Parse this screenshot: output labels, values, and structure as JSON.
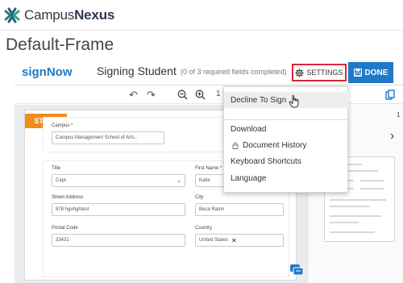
{
  "app": {
    "brand_prefix": "Campus",
    "brand_suffix": "Nexus",
    "frame_title": "Default-Frame"
  },
  "signnow": {
    "logo": "signNow",
    "title": "Signing Student",
    "subtitle": "(0 of 3 required fields completed)",
    "settings_label": "SETTINGS",
    "done_label": "DONE",
    "page_num": "1",
    "thumb_page": "1"
  },
  "document": {
    "start_label": "START",
    "campus_label": "Campus *",
    "campus_value": "Campus Management School of Arts..",
    "title_label": "Title",
    "title_value": "Capt.",
    "first_name_label": "First Name *",
    "first_name_value": "Katie",
    "street_label": "Street Address",
    "street_value": "878 hguhghtest",
    "city_label": "City",
    "city_value": "Boca Raton",
    "postal_label": "Postal Code",
    "postal_value": "33431",
    "country_label": "Country",
    "country_value": "United States"
  },
  "menu": {
    "items": [
      {
        "label": "Decline To Sign"
      },
      {
        "label": "Download"
      },
      {
        "label": "Document History"
      },
      {
        "label": "Keyboard Shortcuts"
      },
      {
        "label": "Language"
      }
    ]
  },
  "colors": {
    "accent": "#1f78c8",
    "start": "#f28c1b",
    "settings_border": "#d9263a"
  }
}
